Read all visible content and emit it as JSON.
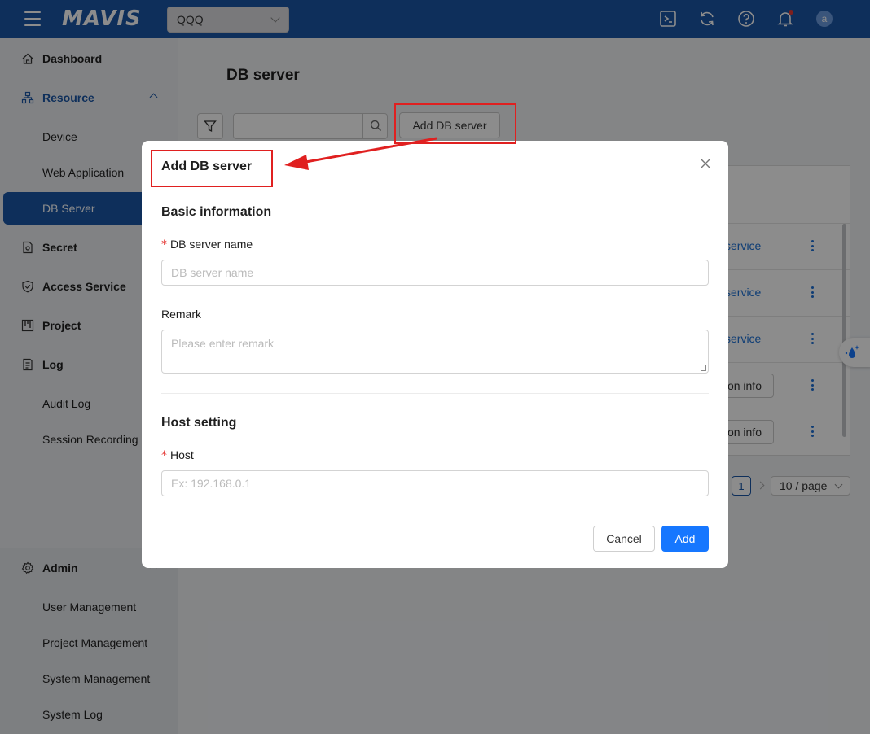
{
  "header": {
    "logo": "MAVIS",
    "project_select": "QQQ",
    "avatar_initial": "a",
    "icons": [
      "terminal-icon",
      "refresh-icon",
      "help-icon",
      "bell-icon"
    ],
    "notification_dot_color": "#e53935",
    "brand_color": "#1a56a6"
  },
  "sidebar": {
    "items": [
      {
        "label": "Dashboard",
        "icon": "home-icon"
      },
      {
        "label": "Resource",
        "icon": "resource-icon"
      },
      {
        "label": "Device"
      },
      {
        "label": "Web Application"
      },
      {
        "label": "DB Server"
      },
      {
        "label": "Secret",
        "icon": "secret-icon"
      },
      {
        "label": "Access Service",
        "icon": "shield-icon"
      },
      {
        "label": "Project",
        "icon": "project-icon"
      },
      {
        "label": "Log",
        "icon": "log-icon"
      },
      {
        "label": "Audit Log"
      },
      {
        "label": "Session Recording"
      },
      {
        "label": "Admin",
        "icon": "gear-icon"
      },
      {
        "label": "User Management"
      },
      {
        "label": "Project Management"
      },
      {
        "label": "System Management"
      },
      {
        "label": "System Log"
      }
    ]
  },
  "main": {
    "title": "DB server",
    "add_button": "Add DB server",
    "table_rows": [
      {
        "text": "service",
        "type": "link"
      },
      {
        "text": "service",
        "type": "link"
      },
      {
        "text": "service",
        "type": "link"
      },
      {
        "text": "on info",
        "type": "button"
      },
      {
        "text": "on info",
        "type": "button"
      }
    ],
    "pagination": {
      "current_page": "1",
      "page_size": "10 / page"
    }
  },
  "modal": {
    "title": "Add DB server",
    "basic_section": "Basic information",
    "name_label": "DB server name",
    "name_placeholder": "DB server name",
    "remark_label": "Remark",
    "remark_placeholder": "Please enter remark",
    "host_section": "Host setting",
    "host_label": "Host",
    "host_placeholder": "Ex: 192.168.0.1",
    "required_mark": "*",
    "cancel": "Cancel",
    "submit": "Add",
    "primary_color": "#1677ff"
  },
  "annotation": {
    "color": "#e02020"
  }
}
